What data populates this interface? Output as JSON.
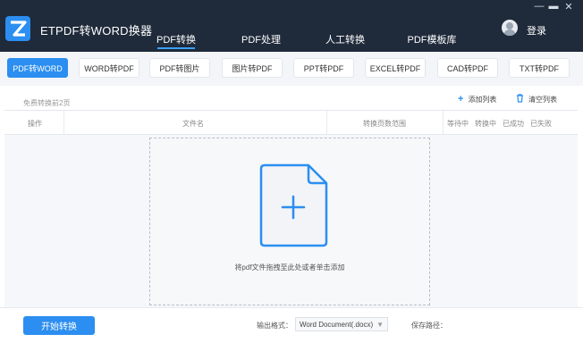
{
  "app": {
    "title": "ETPDF转WORD换器"
  },
  "nav": {
    "tabs": [
      {
        "label": "PDF转换",
        "active": true
      },
      {
        "label": "PDF处理",
        "active": false
      },
      {
        "label": "人工转换",
        "active": false
      },
      {
        "label": "PDF模板库",
        "active": false
      }
    ]
  },
  "window": {
    "minimize": "—",
    "maximize": "▬",
    "close": "✕"
  },
  "user": {
    "login_label": "登录",
    "avatar_icon": "user-avatar-icon"
  },
  "subtabs": [
    {
      "label": "PDF转WORD",
      "active": true
    },
    {
      "label": "WORD转PDF",
      "active": false
    },
    {
      "label": "PDF转图片",
      "active": false
    },
    {
      "label": "图片转PDF",
      "active": false
    },
    {
      "label": "PPT转PDF",
      "active": false
    },
    {
      "label": "EXCEL转PDF",
      "active": false
    },
    {
      "label": "CAD转PDF",
      "active": false
    },
    {
      "label": "TXT转PDF",
      "active": false
    }
  ],
  "toolbar": {
    "free_note": "免费转换前2页",
    "add_list_label": "添加列表",
    "add_list_icon": "plus-icon",
    "clear_list_label": "清空列表",
    "clear_list_icon": "trash-icon"
  },
  "table": {
    "headers": {
      "action": "操作",
      "filename": "文件名",
      "page_range": "转换页数范围",
      "waiting": "等待中",
      "converting": "转换中",
      "succeeded": "已成功",
      "failed": "已失败"
    }
  },
  "dropzone": {
    "hint": "将pdf文件拖拽至此处或者单击添加",
    "icon": "add-document-icon"
  },
  "bottom": {
    "start_label": "开始转换",
    "output_format_label": "输出格式：",
    "output_format_value": "Word Document(.docx)",
    "save_path_label": "保存路径：",
    "save_path_value": ""
  },
  "colors": {
    "titlebar": "#1f2a3a",
    "accent": "#2b8ef0",
    "icon_stroke": "#2b8ef0"
  }
}
